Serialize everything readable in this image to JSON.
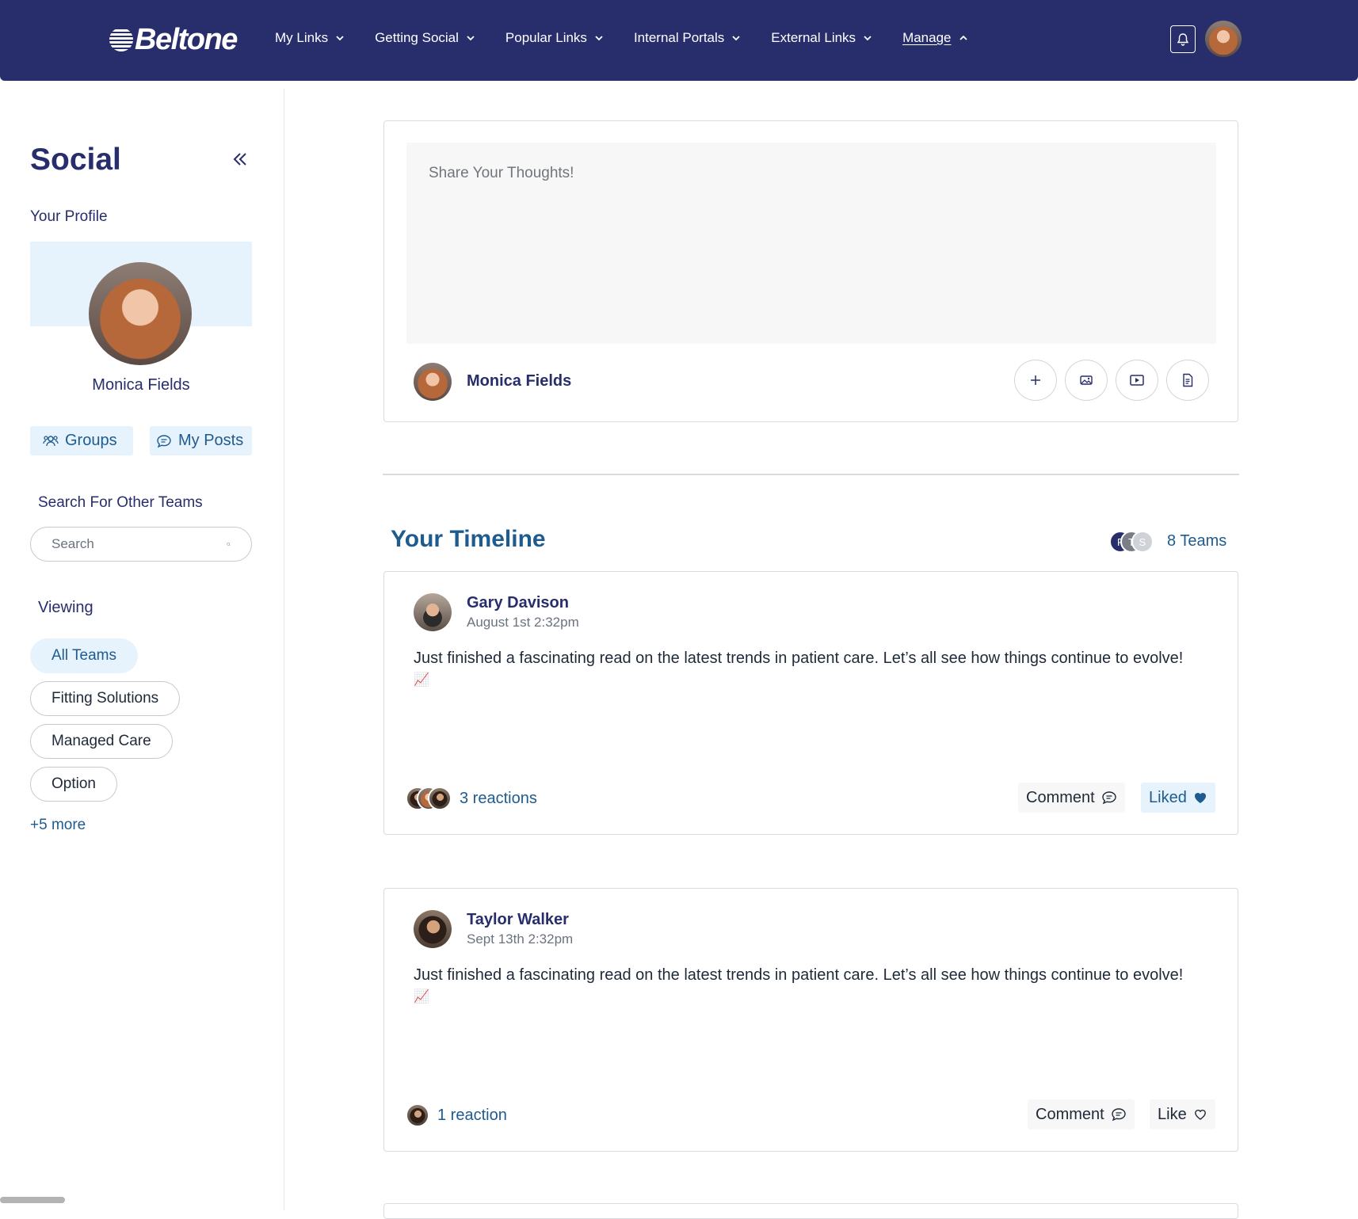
{
  "brand": {
    "name": "Beltone",
    "primary": "#272e6b",
    "accent": "#1e5b8f",
    "highlight": "#e6f3fc"
  },
  "nav": {
    "items": [
      "My Links",
      "Getting Social",
      "Popular Links",
      "Internal Portals",
      "External Links"
    ],
    "manage": "Manage"
  },
  "sidebar": {
    "title": "Social",
    "your_profile": "Your Profile",
    "profile_name": "Monica Fields",
    "groups_tab": "Groups",
    "my_posts_tab": "My Posts",
    "search_label": "Search For Other Teams",
    "search_placeholder": "Search",
    "viewing_label": "Viewing",
    "filters": [
      "All Teams",
      "Fitting Solutions",
      "Managed Care",
      "Option"
    ],
    "active_filter": "All Teams",
    "more": "+5 more"
  },
  "composer": {
    "placeholder": "Share Your Thoughts!",
    "author": "Monica Fields",
    "tools": [
      "plus-icon",
      "image-icon",
      "video-icon",
      "document-icon"
    ]
  },
  "timeline": {
    "title": "Your Timeline",
    "teams_count_label": "8 Teams",
    "team_initials": [
      "F",
      "T",
      "S"
    ],
    "posts": [
      {
        "author": "Gary Davison",
        "time": "August 1st 2:32pm",
        "body": "Just finished a fascinating read on the latest trends in patient care. Let’s  all see how things continue to evolve!",
        "emoji": "📈",
        "reactions": "3 reactions",
        "comment_label": "Comment",
        "like_label": "Liked",
        "liked": true
      },
      {
        "author": "Taylor Walker",
        "time": "Sept 13th 2:32pm",
        "body": "Just finished a fascinating read on the latest trends in patient care. Let’s  all see how things continue to evolve!",
        "emoji": "📈",
        "reactions": "1 reaction",
        "comment_label": "Comment",
        "like_label": "Like",
        "liked": false
      }
    ]
  }
}
